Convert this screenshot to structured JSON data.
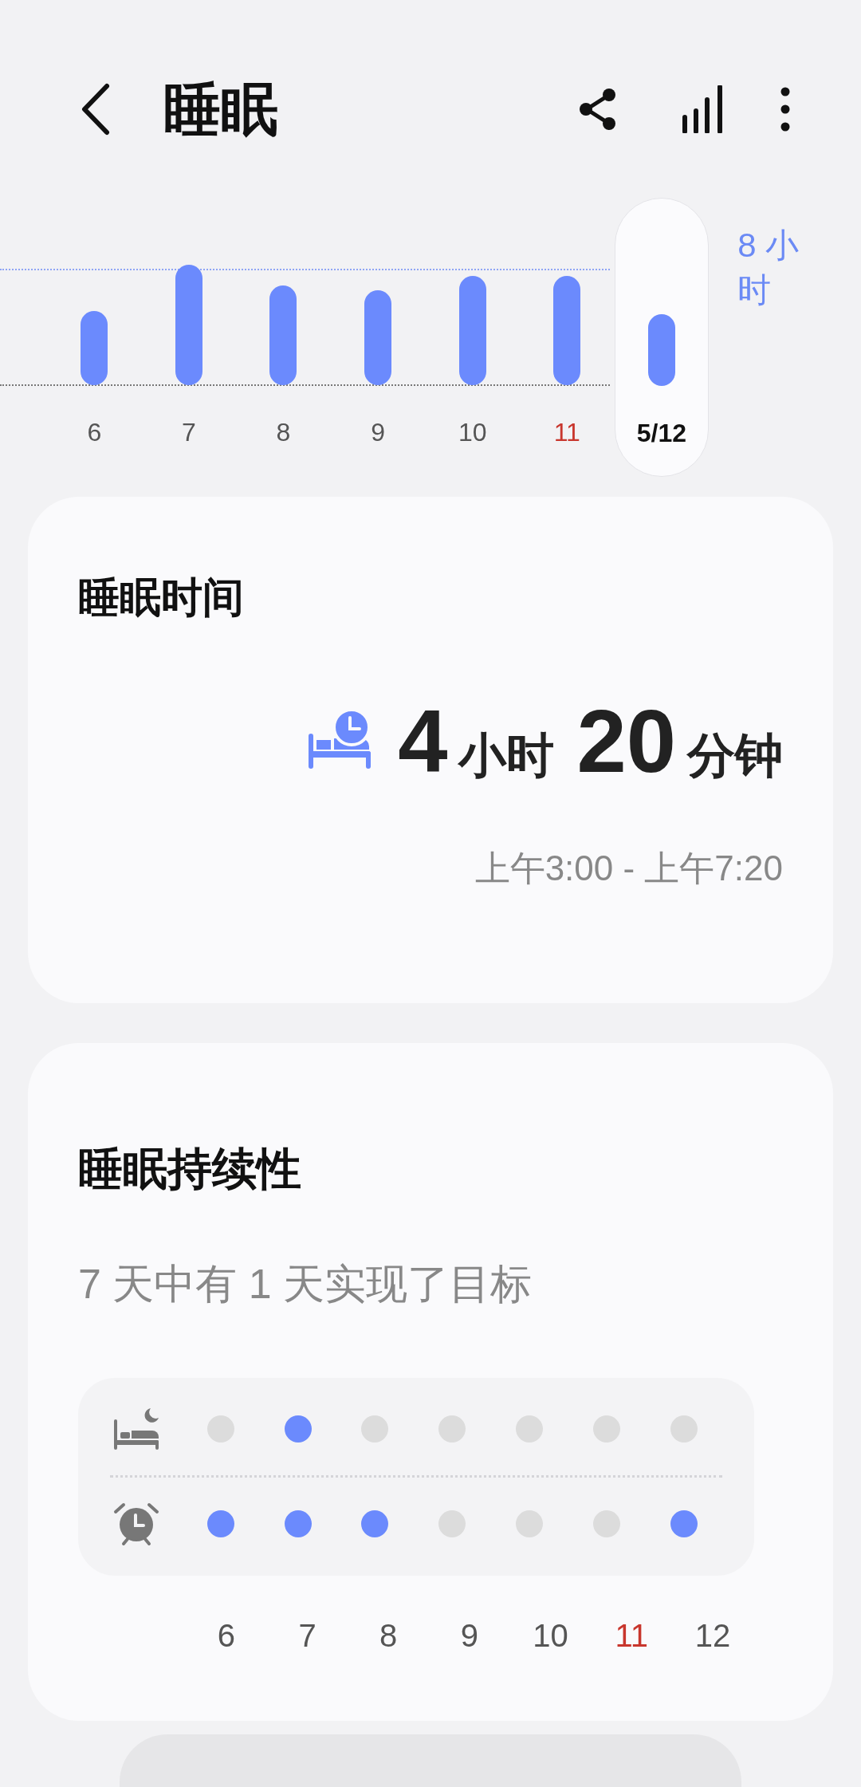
{
  "header": {
    "title": "睡眠"
  },
  "chart": {
    "goal_label": "8 小时",
    "days": [
      {
        "label": "6",
        "selected": false,
        "color": "#555555"
      },
      {
        "label": "7",
        "selected": false,
        "color": "#555555"
      },
      {
        "label": "8",
        "selected": false,
        "color": "#555555"
      },
      {
        "label": "9",
        "selected": false,
        "color": "#555555"
      },
      {
        "label": "10",
        "selected": false,
        "color": "#555555"
      },
      {
        "label": "11",
        "selected": false,
        "color": "#c8362d"
      },
      {
        "label": "5/12",
        "selected": true,
        "color": "#111111"
      }
    ]
  },
  "sleep_time": {
    "title": "睡眠时间",
    "hours": "4",
    "hours_unit": "小时",
    "minutes": "20",
    "minutes_unit": "分钟",
    "range": "上午3:00 - 上午7:20"
  },
  "consistency": {
    "title": "睡眠持续性",
    "summary": "7 天中有 1 天实现了目标",
    "rows": [
      {
        "kind": "bedtime",
        "days": [
          {
            "achieved": false
          },
          {
            "achieved": true
          },
          {
            "achieved": false
          },
          {
            "achieved": false
          },
          {
            "achieved": false
          },
          {
            "achieved": false
          },
          {
            "achieved": false
          }
        ]
      },
      {
        "kind": "wakeup",
        "days": [
          {
            "achieved": true
          },
          {
            "achieved": true
          },
          {
            "achieved": true
          },
          {
            "achieved": false
          },
          {
            "achieved": false
          },
          {
            "achieved": false
          },
          {
            "achieved": true
          }
        ]
      }
    ],
    "day_labels": [
      {
        "label": "6",
        "color": "#555555"
      },
      {
        "label": "7",
        "color": "#555555"
      },
      {
        "label": "8",
        "color": "#555555"
      },
      {
        "label": "9",
        "color": "#555555"
      },
      {
        "label": "10",
        "color": "#555555"
      },
      {
        "label": "11",
        "color": "#c8362d"
      },
      {
        "label": "12",
        "color": "#555555"
      }
    ]
  }
}
